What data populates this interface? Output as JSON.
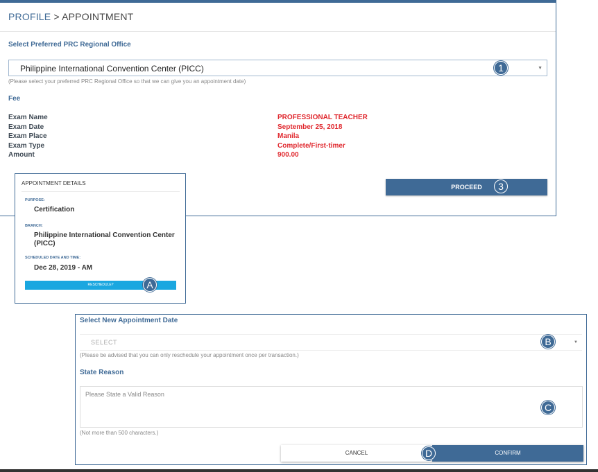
{
  "breadcrumb": {
    "parent": "PROFILE",
    "separator": " > ",
    "current": "APPOINTMENT"
  },
  "office_section": {
    "title": "Select Preferred PRC Regional Office",
    "selected_office": "Philippine International Convention Center (PICC)",
    "helper": "(Please select your preferred PRC Regional Office so that we can give you an appointment date)"
  },
  "fee_section": {
    "title": "Fee",
    "rows": [
      {
        "label": "Exam Name",
        "value": "PROFESSIONAL TEACHER"
      },
      {
        "label": "Exam Date",
        "value": "September 25, 2018"
      },
      {
        "label": "Exam Place",
        "value": "Manila"
      },
      {
        "label": "Exam Type",
        "value": "Complete/First-timer"
      },
      {
        "label": "Amount",
        "value": "900.00"
      }
    ]
  },
  "proceed_label": "PROCEED",
  "appointment_card": {
    "title": "APPOINTMENT DETAILS",
    "purpose_label": "PURPOSE:",
    "purpose": "Certification",
    "branch_label": "BRANCH:",
    "branch_line1": "Philippine International Convention Center",
    "branch_line2": "(PICC)",
    "schedule_label": "SCHEDULED DATE AND TIME:",
    "schedule": "Dec 28, 2019 - AM",
    "reschedule_label": "RESCHEDULE?"
  },
  "reschedule_form": {
    "date_title": "Select New Appointment Date",
    "date_placeholder": "SELECT",
    "date_helper": "(Please be advised that you can only reschedule your appointment once per transaction.)",
    "reason_title": "State Reason",
    "reason_placeholder": "Please State a Valid Reason",
    "reason_helper": "(Not more than 500 characters.)",
    "cancel_label": "CANCEL",
    "confirm_label": "CONFIRM"
  },
  "badges": {
    "one": "1",
    "three": "3",
    "a": "A",
    "b": "B",
    "c": "C",
    "d": "D"
  },
  "colors": {
    "primary": "#3f6a96",
    "accent_red": "#e0282e",
    "reschedule_blue": "#1aa7e0"
  }
}
